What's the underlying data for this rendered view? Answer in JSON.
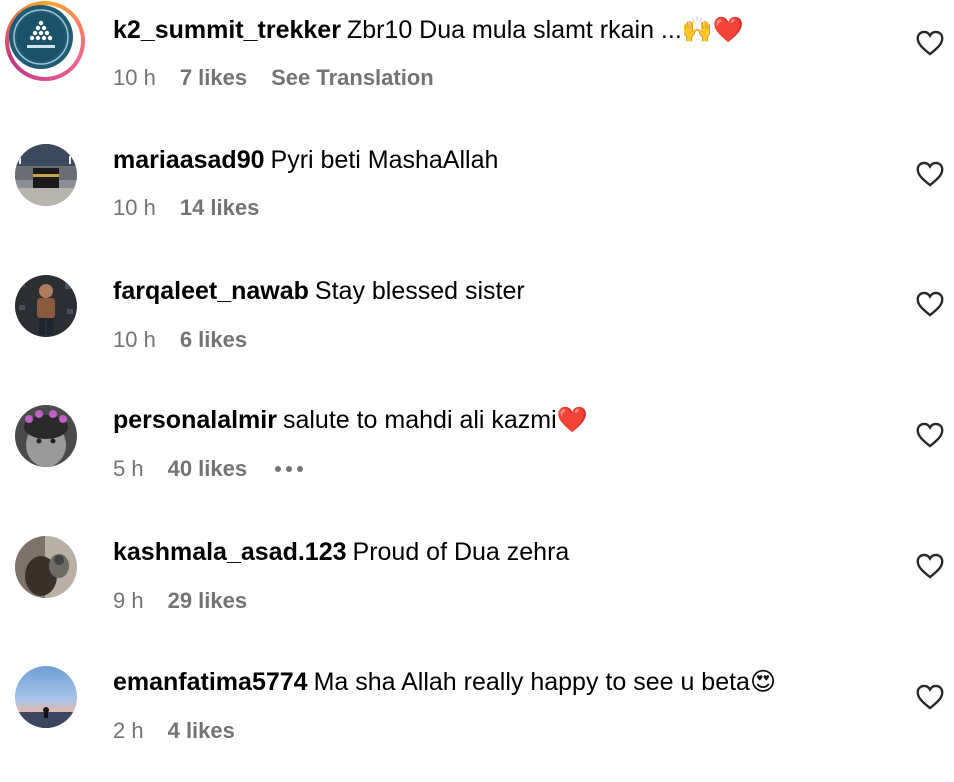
{
  "comments": [
    {
      "username": "k2_summit_trekker",
      "text": "Zbr10 Dua mula slamt rkain ...🙌❤️",
      "time": "10 h",
      "likes": "7 likes",
      "translate": "See Translation",
      "has_story": true
    },
    {
      "username": "mariaasad90",
      "text": "Pyri beti MashaAllah",
      "time": "10 h",
      "likes": "14 likes"
    },
    {
      "username": "farqaleet_nawab",
      "text": "Stay blessed sister",
      "time": "10 h",
      "likes": "6 likes"
    },
    {
      "username": "personalalmir",
      "text": "salute to mahdi ali kazmi❤️",
      "time": "5 h",
      "likes": "40 likes",
      "more": "more-options"
    },
    {
      "username": "kashmala_asad.123",
      "text": "Proud of Dua zehra",
      "time": "9 h",
      "likes": "29 likes"
    },
    {
      "username": "emanfatima5774",
      "text": "Ma sha Allah really happy to see u beta😍",
      "time": "2 h",
      "likes": "4 likes"
    }
  ],
  "icons": {
    "like": "heart-outline-icon",
    "more": "ellipsis-icon"
  },
  "colors": {
    "meta_text": "#737373",
    "username": "#000000"
  }
}
